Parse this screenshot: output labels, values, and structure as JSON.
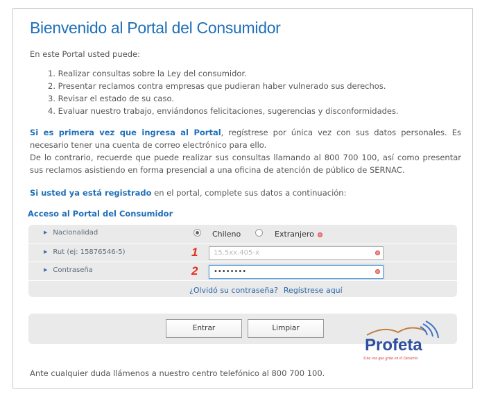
{
  "page": {
    "title": "Bienvenido al Portal del Consumidor",
    "intro": "En este Portal usted puede:",
    "list": [
      "1. Realizar consultas sobre la Ley del consumidor.",
      "2. Presentar reclamos contra empresas que pudieran haber vulnerado sus derechos.",
      "3. Revisar el estado de su caso.",
      "4. Evaluar nuestro trabajo, enviándonos felicitaciones, sugerencias y disconformidades."
    ],
    "para1_strong": "Si es primera vez que ingresa al Portal",
    "para1_rest": ", regístrese por única vez con sus datos personales. Es necesario tener una cuenta de correo electrónico para ello.",
    "para2": "De lo contrario, recuerde que puede realizar sus consultas llamando al 800 700 100, así como presentar sus reclamos asistiendo en forma presencial a una oficina de atención de público de SERNAC.",
    "para3_strong": "Si usted ya está registrado",
    "para3_rest": " en el portal, complete sus datos a continuación:",
    "footer": "Ante cualquier duda llámenos a nuestro centro telefónico al 800 700 100."
  },
  "form": {
    "section_title": "Acceso al Portal del Consumidor",
    "nationality_label": "Nacionalidad",
    "option_chileno": "Chileno",
    "option_extranjero": "Extranjero",
    "rut_label": "Rut (ej: 15876546-5)",
    "rut_value": "15.5xx.405-x",
    "password_label": "Contraseña",
    "password_value": "••••••••",
    "marker_1": "1",
    "marker_2": "2",
    "forgot_link": "¿Olvidó su contraseña?",
    "register_link": "Regístrese aquí",
    "enter_button": "Entrar",
    "clear_button": "Limpiar"
  },
  "watermark": {
    "logo_text": "Profeta",
    "tagline": "Una voz que grita en el Desierto"
  },
  "colors": {
    "accent": "#1f6fb8",
    "marker": "#e03020"
  }
}
